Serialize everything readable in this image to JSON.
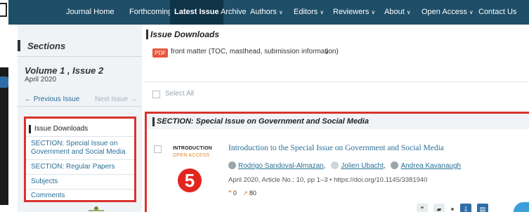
{
  "nav": {
    "items": [
      {
        "label": "Journal Home",
        "chevron": false,
        "active": false
      },
      {
        "label": "Forthcoming",
        "chevron": false,
        "active": false
      },
      {
        "label": "Latest Issue",
        "chevron": false,
        "active": true
      },
      {
        "label": "Archive",
        "chevron": false,
        "active": false
      },
      {
        "label": "Authors",
        "chevron": true,
        "active": false
      },
      {
        "label": "Editors",
        "chevron": true,
        "active": false
      },
      {
        "label": "Reviewers",
        "chevron": true,
        "active": false
      },
      {
        "label": "About",
        "chevron": true,
        "active": false
      },
      {
        "label": "Open Access",
        "chevron": true,
        "active": false
      },
      {
        "label": "Contact Us",
        "chevron": false,
        "active": false
      }
    ],
    "chevron_char": "∨"
  },
  "sidebar": {
    "heading": "Sections",
    "volume": "Volume 1 , Issue 2",
    "date": "April 2020",
    "prev_issue": "← Previous Issue",
    "next_issue": "Next Issue →",
    "toc": [
      {
        "label": "Issue Downloads",
        "active": true
      },
      {
        "label": "SECTION: Special Issue on Government and Social Media",
        "active": false
      },
      {
        "label": "SECTION: Regular Papers",
        "active": false
      },
      {
        "label": "Subjects",
        "active": false
      },
      {
        "label": "Comments",
        "active": false
      }
    ]
  },
  "main": {
    "downloads_heading": "Issue Downloads",
    "pdf_badge": "PDF",
    "front_matter": "front matter (TOC, masthead, submission information)",
    "download_icon": "⤓",
    "select_all": "Select All",
    "section_heading": "SECTION: Special Issue on Government and Social Media",
    "article": {
      "type": "INTRODUCTION",
      "access": "OPEN ACCESS",
      "marker": "5",
      "title": "Introduction to the Special Issue on Government and Social Media",
      "authors": [
        "Rodrigo Sandoval-Almazan",
        "Jolien Ubacht",
        "Andrea Kavanaugh"
      ],
      "meta": "April 2020, Article No.: 10, pp 1–3 • https://doi.org/10.1145/3381940",
      "citations_icon": "❞",
      "citations": "0",
      "views_icon": "↗",
      "views": "80"
    }
  },
  "colors": {
    "nav_bg": "#1f4e68",
    "highlight_border": "#d9332b",
    "link": "#2a6f97",
    "open_access": "#e08a2a"
  }
}
